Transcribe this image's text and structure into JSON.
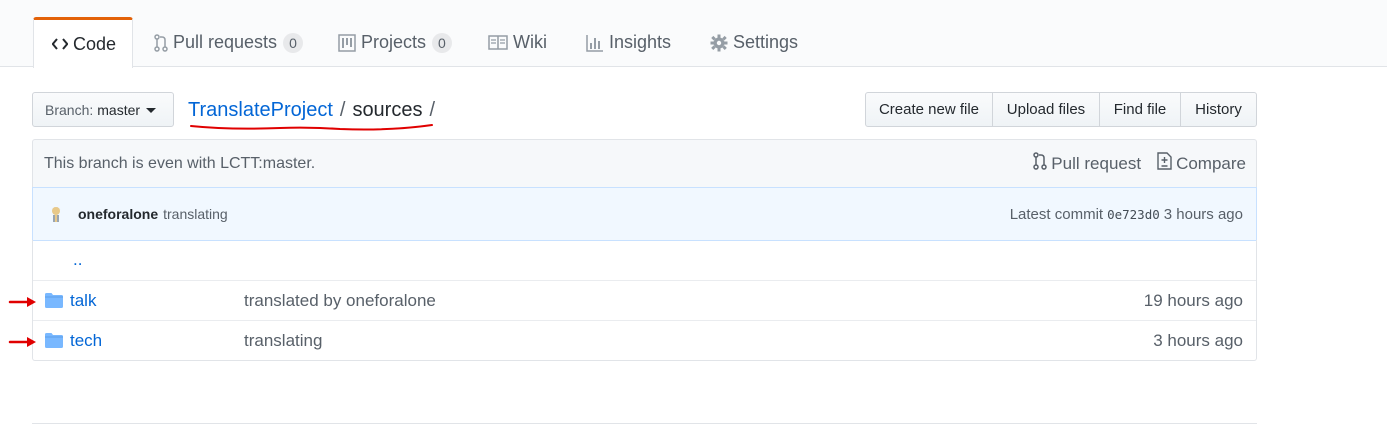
{
  "tabs": [
    {
      "label": "Code",
      "icon": "code-icon"
    },
    {
      "label": "Pull requests",
      "icon": "git-pull-request-icon",
      "count": "0"
    },
    {
      "label": "Projects",
      "icon": "project-icon",
      "count": "0"
    },
    {
      "label": "Wiki",
      "icon": "book-icon"
    },
    {
      "label": "Insights",
      "icon": "graph-icon"
    },
    {
      "label": "Settings",
      "icon": "gear-icon"
    }
  ],
  "branch": {
    "prefix": "Branch:",
    "name": "master"
  },
  "breadcrumb": {
    "repo": "TranslateProject",
    "sep": "/",
    "dir": "sources",
    "trailing": "/"
  },
  "file_actions": [
    "Create new file",
    "Upload files",
    "Find file",
    "History"
  ],
  "branch_info": {
    "text": "This branch is even with LCTT:master.",
    "pull_request": "Pull request",
    "compare": "Compare"
  },
  "commit": {
    "author": "oneforalone",
    "message": "translating",
    "latest_label": "Latest commit",
    "sha": "0e723d0",
    "age": "3 hours ago"
  },
  "files": [
    {
      "name": "..",
      "type": "parent",
      "message": "",
      "age": ""
    },
    {
      "name": "talk",
      "type": "folder",
      "message": "translated by oneforalone",
      "age": "19 hours ago"
    },
    {
      "name": "tech",
      "type": "folder",
      "message": "translating",
      "age": "3 hours ago"
    }
  ],
  "colors": {
    "accent": "#e36209",
    "link": "#0366d6",
    "annotation": "#e00000",
    "folder": "#79b8ff"
  }
}
